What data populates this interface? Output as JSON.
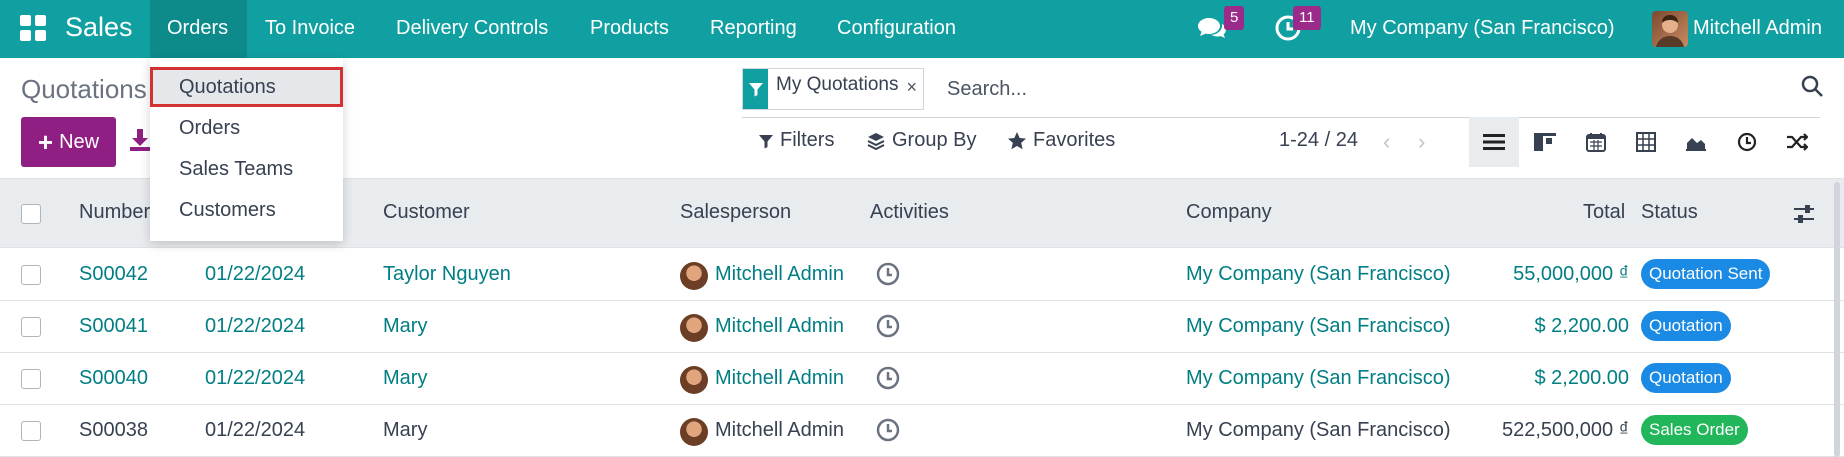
{
  "navbar": {
    "app_name": "Sales",
    "menu": [
      "Orders",
      "To Invoice",
      "Delivery Controls",
      "Products",
      "Reporting",
      "Configuration"
    ],
    "messages_count": "5",
    "activities_count": "11",
    "company": "My Company (San Francisco)",
    "user": "Mitchell Admin"
  },
  "orders_dropdown": {
    "items": [
      "Quotations",
      "Orders",
      "Sales Teams",
      "Customers"
    ],
    "highlighted": "Quotations"
  },
  "control_panel": {
    "breadcrumb": "Quotations",
    "new_label": "New",
    "facet_label": "My Quotations",
    "facet_close": "×",
    "search_placeholder": "Search...",
    "filters_label": "Filters",
    "groupby_label": "Group By",
    "favorites_label": "Favorites",
    "pager": "1-24 / 24",
    "pager_prev": "‹",
    "pager_next": "›"
  },
  "table": {
    "columns": {
      "number": "Number",
      "customer": "Customer",
      "salesperson": "Salesperson",
      "activities": "Activities",
      "company": "Company",
      "total": "Total",
      "status": "Status"
    },
    "rows": [
      {
        "number": "S00042",
        "date": "01/22/2024",
        "customer": "Taylor Nguyen",
        "salesperson": "Mitchell Admin",
        "company": "My Company (San Francisco)",
        "total": "55,000,000 ₫",
        "status": "Quotation Sent",
        "status_color": "#1a8ae5",
        "linked": true
      },
      {
        "number": "S00041",
        "date": "01/22/2024",
        "customer": "Mary",
        "salesperson": "Mitchell Admin",
        "company": "My Company (San Francisco)",
        "total": "$ 2,200.00",
        "status": "Quotation",
        "status_color": "#1a8ae5",
        "linked": true
      },
      {
        "number": "S00040",
        "date": "01/22/2024",
        "customer": "Mary",
        "salesperson": "Mitchell Admin",
        "company": "My Company (San Francisco)",
        "total": "$ 2,200.00",
        "status": "Quotation",
        "status_color": "#1a8ae5",
        "linked": true
      },
      {
        "number": "S00038",
        "date": "01/22/2024",
        "customer": "Mary",
        "salesperson": "Mitchell Admin",
        "company": "My Company (San Francisco)",
        "total": "522,500,000 ₫",
        "status": "Sales Order",
        "status_color": "#21b659",
        "linked": false
      }
    ]
  },
  "colors": {
    "navbar": "#11a0a1",
    "primary_button": "#8f1f83",
    "link": "#017e84",
    "badge": "#9b2a8a"
  }
}
